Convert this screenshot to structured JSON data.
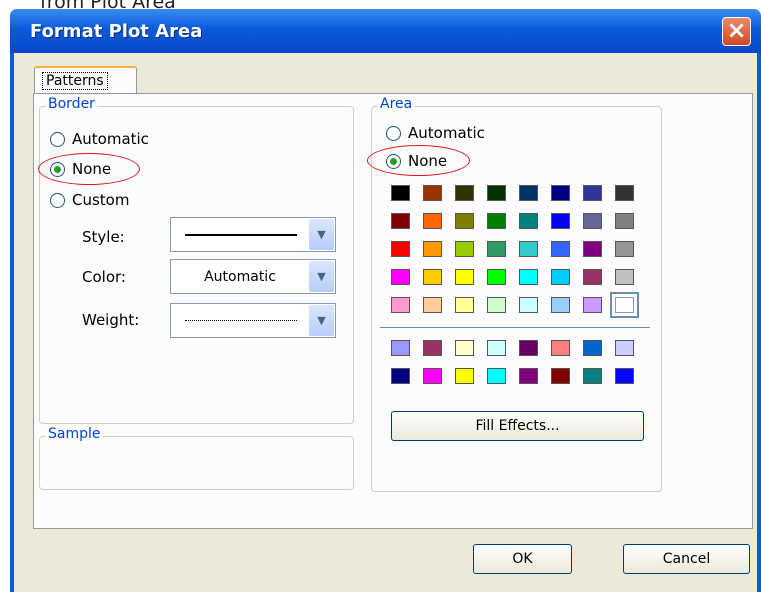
{
  "caption": "from Plot Area",
  "title": "Format Plot Area",
  "tab_label": "Patterns",
  "border": {
    "legend": "Border",
    "options": [
      "Automatic",
      "None",
      "Custom"
    ],
    "selected": "None",
    "style_label": "Style:",
    "color_label": "Color:",
    "color_value": "Automatic",
    "weight_label": "Weight:"
  },
  "sample_legend": "Sample",
  "area": {
    "legend": "Area",
    "options": [
      "Automatic",
      "None"
    ],
    "selected": "None",
    "palette_rows": [
      [
        "#000000",
        "#993300",
        "#333300",
        "#003300",
        "#003366",
        "#000080",
        "#333399",
        "#333333"
      ],
      [
        "#800000",
        "#ff6600",
        "#808000",
        "#008000",
        "#008080",
        "#0000ff",
        "#666699",
        "#808080"
      ],
      [
        "#ff0000",
        "#ff9900",
        "#99cc00",
        "#339966",
        "#33cccc",
        "#3366ff",
        "#800080",
        "#969696"
      ],
      [
        "#ff00ff",
        "#ffcc00",
        "#ffff00",
        "#00ff00",
        "#00ffff",
        "#00ccff",
        "#993366",
        "#c0c0c0"
      ],
      [
        "#ff99cc",
        "#ffcc99",
        "#ffff99",
        "#ccffcc",
        "#ccffff",
        "#99ccff",
        "#cc99ff",
        "#ffffff"
      ]
    ],
    "chart_rows": [
      [
        "#9999ff",
        "#993366",
        "#ffffcc",
        "#ccffff",
        "#660066",
        "#ff8080",
        "#0066cc",
        "#ccccff"
      ],
      [
        "#000080",
        "#ff00ff",
        "#ffff00",
        "#00ffff",
        "#800080",
        "#800000",
        "#008080",
        "#0000ff"
      ]
    ],
    "selected_color": "#ffffff",
    "fill_effects_label": "Fill Effects..."
  },
  "ok_label": "OK",
  "cancel_label": "Cancel",
  "accent_red": "#e01818",
  "titlebar_color": "#0a5bdc"
}
